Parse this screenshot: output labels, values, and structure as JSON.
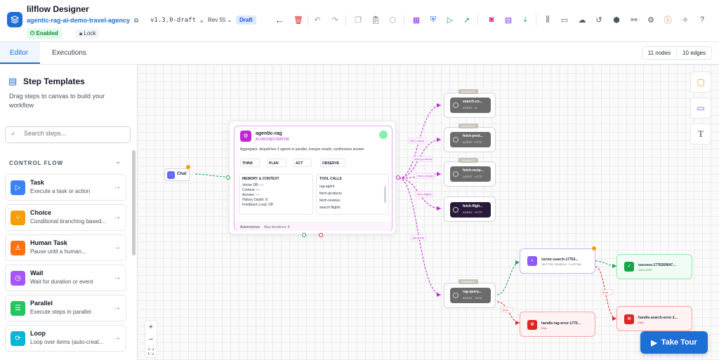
{
  "header": {
    "app_title": "lilflow Designer",
    "workflow_name": "agentic-rag-ai-demo-travel-agency",
    "version": "v1.3.0-draft",
    "revision": "Rev 55",
    "status": "Draft",
    "enabled_badge": "Enabled",
    "lock_label": "Lock"
  },
  "tabs": [
    {
      "label": "Editor"
    },
    {
      "label": "Executions"
    }
  ],
  "stats": {
    "nodes": "11 nodes",
    "edges": "10 edges"
  },
  "sidebar": {
    "title": "Step Templates",
    "description": "Drag steps to canvas to build your workflow",
    "search_placeholder": "Search steps...",
    "section": "CONTROL FLOW",
    "items": [
      {
        "name": "Task",
        "desc": "Execute a task or action",
        "color": "#3b82f6"
      },
      {
        "name": "Choice",
        "desc": "Conditional branching based...",
        "color": "#f59e0b"
      },
      {
        "name": "Human Task",
        "desc": "Pause until a human...",
        "color": "#f97316"
      },
      {
        "name": "Wait",
        "desc": "Wait for duration or event",
        "color": "#a855f7"
      },
      {
        "name": "Parallel",
        "desc": "Execute steps in parallel",
        "color": "#22c55e"
      },
      {
        "name": "Loop",
        "desc": "Loop over items (auto-creat...",
        "color": "#06b6d4"
      }
    ]
  },
  "canvas": {
    "chat_label": "Chat",
    "agentic": {
      "title": "agentic-rag",
      "subtitle": "AI ORCHESTRATOR",
      "description": "Aggregator: dispatches 3 agents in parallel, merges results, synthesizes answer",
      "steps": [
        "THINK",
        "PLAN",
        "ACT",
        "OBSERVE"
      ],
      "memory_title": "MEMORY & CONTEXT",
      "memory_lines": [
        "Vector DB: —",
        "Context: —",
        "Answer: —",
        "History Depth: 8",
        "Feedback Loop: Off"
      ],
      "tools_title": "TOOL CALLS",
      "tools": [
        "rag-agent",
        "fetch-products",
        "fetch-reviews",
        "search-flights"
      ],
      "footer_left": "Autonomous",
      "footer_right": "Max iterations: 8"
    },
    "agents": [
      {
        "chip": "DISABLED",
        "title": "search-co...",
        "sub": "AGENT · AI"
      },
      {
        "chip": "DISABLED",
        "title": "fetch-prod...",
        "sub": "AGENT · HTTP"
      },
      {
        "chip": "DISABLED",
        "title": "fetch-recip...",
        "sub": "AGENT · HTTP"
      },
      {
        "chip": "",
        "title": "fetch-fligh...",
        "sub": "AGENT · HTTP"
      },
      {
        "chip": "DISABLED",
        "title": "rag-query...",
        "sub": "AGENT · TASK"
      }
    ],
    "edge_labels": [
      "fetch-hotels",
      "fetch-products",
      "fetch-recipes",
      "fetch-flights",
      "rag-query",
      "error",
      "error"
    ],
    "vector": {
      "title": "vector-search-17763...",
      "sub": "VECTOR_SEARCH · CUSTOM"
    },
    "success": {
      "title": "success-1776269647...",
      "sub": "SUCCESS"
    },
    "rag_error": {
      "title": "handle-rag-error-1770...",
      "sub": "FAIL"
    },
    "search_error": {
      "title": "handle-search-error-1...",
      "sub": "FAIL"
    }
  },
  "tour_label": "Take Tour"
}
